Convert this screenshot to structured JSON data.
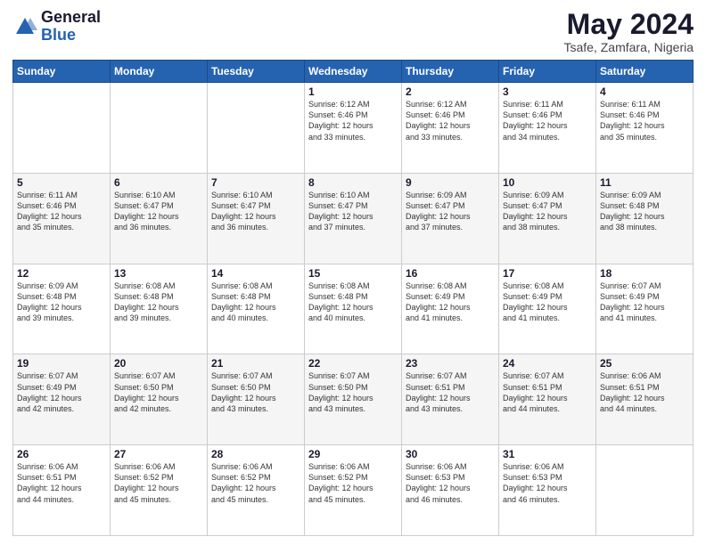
{
  "header": {
    "logo_general": "General",
    "logo_blue": "Blue",
    "month_title": "May 2024",
    "location": "Tsafe, Zamfara, Nigeria"
  },
  "weekdays": [
    "Sunday",
    "Monday",
    "Tuesday",
    "Wednesday",
    "Thursday",
    "Friday",
    "Saturday"
  ],
  "weeks": [
    [
      {
        "day": "",
        "info": ""
      },
      {
        "day": "",
        "info": ""
      },
      {
        "day": "",
        "info": ""
      },
      {
        "day": "1",
        "info": "Sunrise: 6:12 AM\nSunset: 6:46 PM\nDaylight: 12 hours\nand 33 minutes."
      },
      {
        "day": "2",
        "info": "Sunrise: 6:12 AM\nSunset: 6:46 PM\nDaylight: 12 hours\nand 33 minutes."
      },
      {
        "day": "3",
        "info": "Sunrise: 6:11 AM\nSunset: 6:46 PM\nDaylight: 12 hours\nand 34 minutes."
      },
      {
        "day": "4",
        "info": "Sunrise: 6:11 AM\nSunset: 6:46 PM\nDaylight: 12 hours\nand 35 minutes."
      }
    ],
    [
      {
        "day": "5",
        "info": "Sunrise: 6:11 AM\nSunset: 6:46 PM\nDaylight: 12 hours\nand 35 minutes."
      },
      {
        "day": "6",
        "info": "Sunrise: 6:10 AM\nSunset: 6:47 PM\nDaylight: 12 hours\nand 36 minutes."
      },
      {
        "day": "7",
        "info": "Sunrise: 6:10 AM\nSunset: 6:47 PM\nDaylight: 12 hours\nand 36 minutes."
      },
      {
        "day": "8",
        "info": "Sunrise: 6:10 AM\nSunset: 6:47 PM\nDaylight: 12 hours\nand 37 minutes."
      },
      {
        "day": "9",
        "info": "Sunrise: 6:09 AM\nSunset: 6:47 PM\nDaylight: 12 hours\nand 37 minutes."
      },
      {
        "day": "10",
        "info": "Sunrise: 6:09 AM\nSunset: 6:47 PM\nDaylight: 12 hours\nand 38 minutes."
      },
      {
        "day": "11",
        "info": "Sunrise: 6:09 AM\nSunset: 6:48 PM\nDaylight: 12 hours\nand 38 minutes."
      }
    ],
    [
      {
        "day": "12",
        "info": "Sunrise: 6:09 AM\nSunset: 6:48 PM\nDaylight: 12 hours\nand 39 minutes."
      },
      {
        "day": "13",
        "info": "Sunrise: 6:08 AM\nSunset: 6:48 PM\nDaylight: 12 hours\nand 39 minutes."
      },
      {
        "day": "14",
        "info": "Sunrise: 6:08 AM\nSunset: 6:48 PM\nDaylight: 12 hours\nand 40 minutes."
      },
      {
        "day": "15",
        "info": "Sunrise: 6:08 AM\nSunset: 6:48 PM\nDaylight: 12 hours\nand 40 minutes."
      },
      {
        "day": "16",
        "info": "Sunrise: 6:08 AM\nSunset: 6:49 PM\nDaylight: 12 hours\nand 41 minutes."
      },
      {
        "day": "17",
        "info": "Sunrise: 6:08 AM\nSunset: 6:49 PM\nDaylight: 12 hours\nand 41 minutes."
      },
      {
        "day": "18",
        "info": "Sunrise: 6:07 AM\nSunset: 6:49 PM\nDaylight: 12 hours\nand 41 minutes."
      }
    ],
    [
      {
        "day": "19",
        "info": "Sunrise: 6:07 AM\nSunset: 6:49 PM\nDaylight: 12 hours\nand 42 minutes."
      },
      {
        "day": "20",
        "info": "Sunrise: 6:07 AM\nSunset: 6:50 PM\nDaylight: 12 hours\nand 42 minutes."
      },
      {
        "day": "21",
        "info": "Sunrise: 6:07 AM\nSunset: 6:50 PM\nDaylight: 12 hours\nand 43 minutes."
      },
      {
        "day": "22",
        "info": "Sunrise: 6:07 AM\nSunset: 6:50 PM\nDaylight: 12 hours\nand 43 minutes."
      },
      {
        "day": "23",
        "info": "Sunrise: 6:07 AM\nSunset: 6:51 PM\nDaylight: 12 hours\nand 43 minutes."
      },
      {
        "day": "24",
        "info": "Sunrise: 6:07 AM\nSunset: 6:51 PM\nDaylight: 12 hours\nand 44 minutes."
      },
      {
        "day": "25",
        "info": "Sunrise: 6:06 AM\nSunset: 6:51 PM\nDaylight: 12 hours\nand 44 minutes."
      }
    ],
    [
      {
        "day": "26",
        "info": "Sunrise: 6:06 AM\nSunset: 6:51 PM\nDaylight: 12 hours\nand 44 minutes."
      },
      {
        "day": "27",
        "info": "Sunrise: 6:06 AM\nSunset: 6:52 PM\nDaylight: 12 hours\nand 45 minutes."
      },
      {
        "day": "28",
        "info": "Sunrise: 6:06 AM\nSunset: 6:52 PM\nDaylight: 12 hours\nand 45 minutes."
      },
      {
        "day": "29",
        "info": "Sunrise: 6:06 AM\nSunset: 6:52 PM\nDaylight: 12 hours\nand 45 minutes."
      },
      {
        "day": "30",
        "info": "Sunrise: 6:06 AM\nSunset: 6:53 PM\nDaylight: 12 hours\nand 46 minutes."
      },
      {
        "day": "31",
        "info": "Sunrise: 6:06 AM\nSunset: 6:53 PM\nDaylight: 12 hours\nand 46 minutes."
      },
      {
        "day": "",
        "info": ""
      }
    ]
  ]
}
